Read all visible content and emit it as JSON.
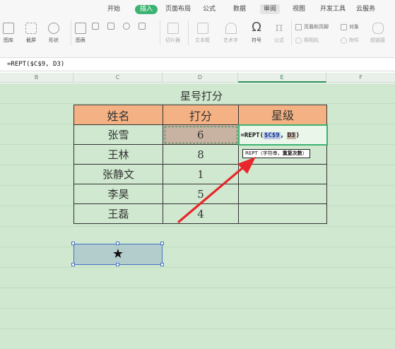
{
  "ribbon": {
    "tabs": [
      {
        "label": "开始",
        "active": false
      },
      {
        "label": "插入",
        "active": true
      },
      {
        "label": "页面布局",
        "active": false
      },
      {
        "label": "公式",
        "active": false
      },
      {
        "label": "数据",
        "active": false
      },
      {
        "label": "审阅",
        "active": false
      },
      {
        "label": "视图",
        "active": false
      },
      {
        "label": "开发工具",
        "active": false
      },
      {
        "label": "云服务",
        "active": false
      }
    ],
    "tools": {
      "gallery": "图库",
      "screenshot": "截屏",
      "shapes": "形状",
      "icons": "图表",
      "clipboard_image": "切片器",
      "textbox": "文本框",
      "wordart": "艺术字",
      "symbol": "符号",
      "formula": "公式",
      "header_footer": "页眉和页脚",
      "object": "对象",
      "camera": "照相机",
      "attachment": "附件",
      "hyperlink": "超链接"
    },
    "accent_color": "#3cb371"
  },
  "formula_bar": {
    "text": "=REPT($C$9, D3)"
  },
  "columns": [
    "B",
    "C",
    "D",
    "E",
    "F"
  ],
  "sheet": {
    "title": "星号打分",
    "headers": {
      "name": "姓名",
      "score": "打分",
      "stars": "星级"
    },
    "rows": [
      {
        "name": "张雪",
        "score": "6"
      },
      {
        "name": "王林",
        "score": "8"
      },
      {
        "name": "张静文",
        "score": "1"
      },
      {
        "name": "李昊",
        "score": "5"
      },
      {
        "name": "王磊",
        "score": "4"
      }
    ],
    "editing_formula": {
      "prefix": "=REPT(",
      "ref1": "$C$9",
      "sep": "，",
      "ref2": "D3",
      "suffix": ")"
    },
    "tooltip": {
      "func": "REPT",
      "args_open": "（",
      "arg1": "字符串",
      "sep": "，",
      "arg2": "重复次数",
      "args_close": "）"
    },
    "star_cell": "★",
    "header_color": "#f4b183",
    "sheet_color": "#cfe8cf"
  }
}
